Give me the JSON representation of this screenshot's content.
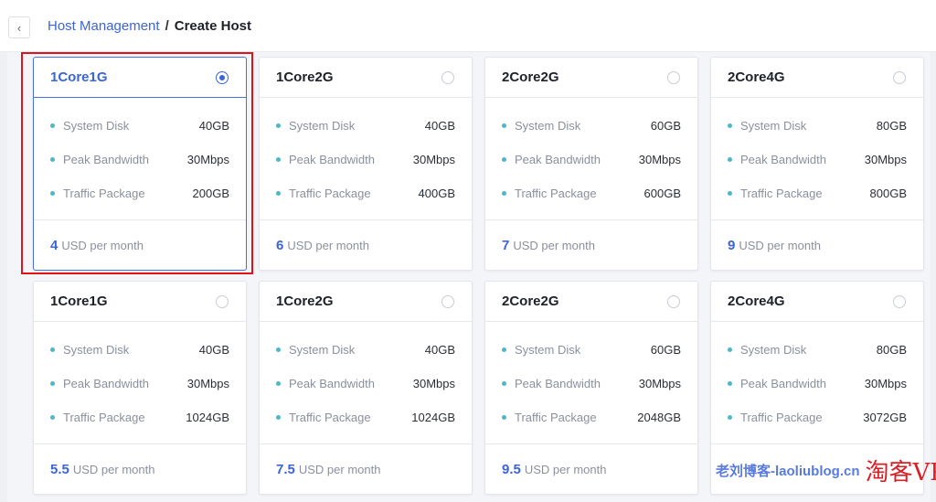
{
  "header": {
    "back_icon": "chevron-left-icon",
    "back_glyph": "‹",
    "breadcrumb_parent": "Host Management",
    "breadcrumb_separator": "/",
    "breadcrumb_current": "Create Host"
  },
  "spec_labels": {
    "disk": "System Disk",
    "bandwidth": "Peak Bandwidth",
    "traffic": "Traffic Package"
  },
  "plans": [
    {
      "name": "1Core1G",
      "selected": true,
      "disk": "40GB",
      "bandwidth": "30Mbps",
      "traffic": "200GB",
      "price": "4",
      "unit": "USD per month"
    },
    {
      "name": "1Core2G",
      "selected": false,
      "disk": "40GB",
      "bandwidth": "30Mbps",
      "traffic": "400GB",
      "price": "6",
      "unit": "USD per month"
    },
    {
      "name": "2Core2G",
      "selected": false,
      "disk": "60GB",
      "bandwidth": "30Mbps",
      "traffic": "600GB",
      "price": "7",
      "unit": "USD per month"
    },
    {
      "name": "2Core4G",
      "selected": false,
      "disk": "80GB",
      "bandwidth": "30Mbps",
      "traffic": "800GB",
      "price": "9",
      "unit": "USD per month"
    },
    {
      "name": "1Core1G",
      "selected": false,
      "disk": "40GB",
      "bandwidth": "30Mbps",
      "traffic": "1024GB",
      "price": "5.5",
      "unit": "USD per month"
    },
    {
      "name": "1Core2G",
      "selected": false,
      "disk": "40GB",
      "bandwidth": "30Mbps",
      "traffic": "1024GB",
      "price": "7.5",
      "unit": "USD per month"
    },
    {
      "name": "2Core2G",
      "selected": false,
      "disk": "60GB",
      "bandwidth": "30Mbps",
      "traffic": "2048GB",
      "price": "9.5",
      "unit": "USD per month"
    },
    {
      "name": "2Core4G",
      "selected": false,
      "disk": "80GB",
      "bandwidth": "30Mbps",
      "traffic": "3072GB",
      "price": "",
      "unit": ""
    }
  ],
  "watermark": {
    "blue_text": "老刘博客-laoliublog.cn",
    "red_text": "淘客VPS"
  },
  "colors": {
    "accent": "#3c64d8",
    "highlight_border": "#e0131b",
    "bullet": "#4cb7c7"
  }
}
